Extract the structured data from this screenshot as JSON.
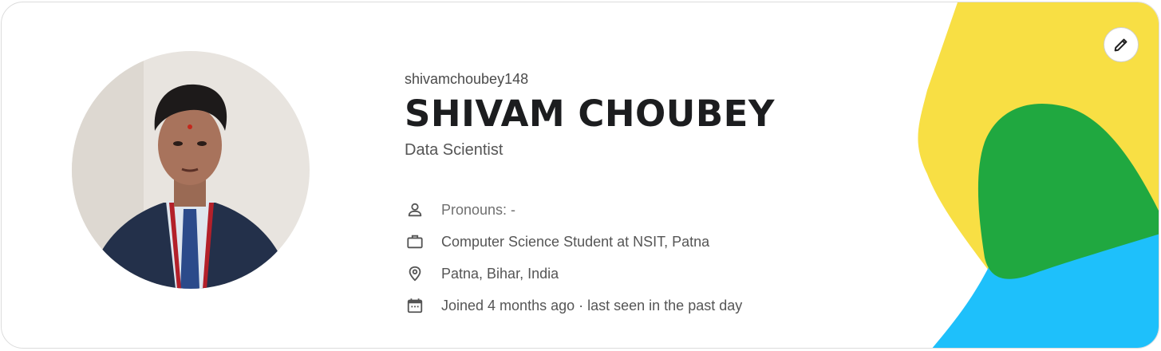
{
  "profile": {
    "username": "shivamchoubey148",
    "full_name": "SHIVAM CHOUBEY",
    "headline": "Data Scientist",
    "pronouns": "Pronouns: -",
    "occupation": "Computer Science Student at NSIT, Patna",
    "location": "Patna, Bihar, India",
    "activity": "Joined 4 months ago · last seen in the past day"
  },
  "icons": {
    "edit": "pencil-icon",
    "pronouns": "person-icon",
    "occupation": "briefcase-icon",
    "location": "location-pin-icon",
    "activity": "calendar-icon"
  },
  "colors": {
    "blob_yellow": "#f8df44",
    "blob_green": "#20a840",
    "blob_blue": "#1ec0fb",
    "name_text": "#1c1d1f",
    "detail_text": "#555555"
  }
}
